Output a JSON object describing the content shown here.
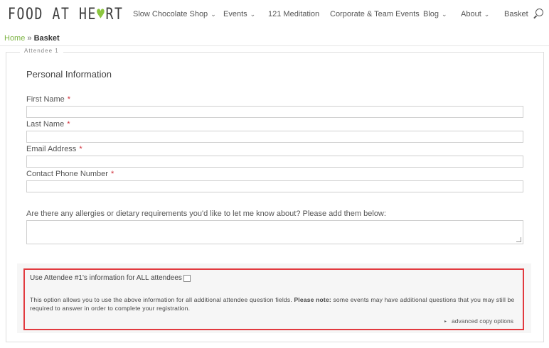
{
  "header": {
    "logo": {
      "before": "FOOD AT HE",
      "heart": "♥",
      "after": "RT"
    },
    "nav": [
      {
        "label": "Slow Chocolate Shop",
        "dropdown": true
      },
      {
        "label": "Events",
        "dropdown": true
      },
      {
        "label": "121 Meditation",
        "dropdown": false
      },
      {
        "label": "Corporate & Team Events",
        "dropdown": false
      },
      {
        "label": "Blog",
        "dropdown": true
      },
      {
        "label": "About",
        "dropdown": true
      },
      {
        "label": "Basket",
        "dropdown": false
      }
    ],
    "chevron": "⌄",
    "search_icon": "search-icon"
  },
  "breadcrumb": {
    "home": "Home",
    "separator": " » ",
    "current": "Basket"
  },
  "form": {
    "legend": "Attendee 1",
    "section_title": "Personal Information",
    "required_mark": "*",
    "fields": {
      "first_name": {
        "label": "First Name",
        "value": ""
      },
      "last_name": {
        "label": "Last Name",
        "value": ""
      },
      "email": {
        "label": "Email Address",
        "value": ""
      },
      "phone": {
        "label": "Contact Phone Number",
        "value": ""
      }
    },
    "allergies": {
      "label": "Are there any allergies or dietary requirements you'd like to let me know about? Please add them below:",
      "value": ""
    }
  },
  "copy": {
    "label": "Use Attendee #1's information for ALL attendees",
    "checked": false,
    "note_before": "This option allows you to use the above information for all additional attendee question fields. ",
    "note_bold": "Please note:",
    "note_after": " some events may have additional questions that you may still be required to answer in order to complete your registration.",
    "advanced_link": "advanced copy options",
    "bullet": "▸"
  },
  "colors": {
    "brand_green": "#7cb342",
    "required_red": "#d0303a",
    "highlight_red": "#e23a3f"
  }
}
